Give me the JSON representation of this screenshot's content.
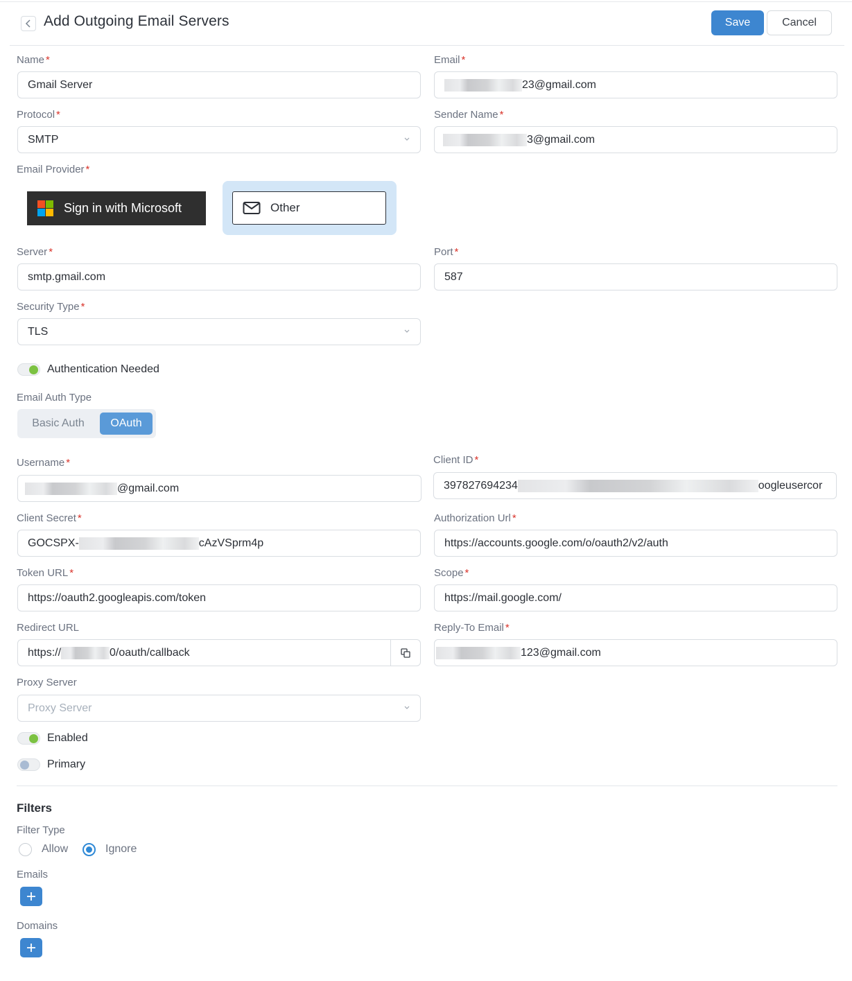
{
  "header": {
    "title": "Add Outgoing Email Servers",
    "save_label": "Save",
    "cancel_label": "Cancel"
  },
  "form": {
    "name": {
      "label": "Name",
      "value": "Gmail Server"
    },
    "email": {
      "label": "Email",
      "value_visible": "23@gmail.com"
    },
    "protocol": {
      "label": "Protocol",
      "value": "SMTP"
    },
    "sender_name": {
      "label": "Sender Name",
      "value_visible": "3@gmail.com"
    },
    "email_provider": {
      "label": "Email Provider",
      "microsoft_label": "Sign in with Microsoft",
      "other_label": "Other",
      "selected": "Other"
    },
    "server": {
      "label": "Server",
      "value": "smtp.gmail.com"
    },
    "port": {
      "label": "Port",
      "value": "587"
    },
    "security_type": {
      "label": "Security Type",
      "value": "TLS"
    },
    "auth_needed": {
      "label": "Authentication Needed",
      "on": true
    },
    "email_auth_type": {
      "label": "Email Auth Type",
      "basic_label": "Basic Auth",
      "oauth_label": "OAuth",
      "selected": "OAuth"
    },
    "username": {
      "label": "Username",
      "value_visible": "@gmail.com"
    },
    "client_id": {
      "label": "Client ID",
      "value_prefix": "397827694234",
      "value_suffix": "oogleusercor"
    },
    "client_secret": {
      "label": "Client Secret",
      "value_prefix": "GOCSPX-",
      "value_suffix": "cAzVSprm4p"
    },
    "authorization_url": {
      "label": "Authorization Url",
      "value": "https://accounts.google.com/o/oauth2/v2/auth"
    },
    "token_url": {
      "label": "Token URL",
      "value": "https://oauth2.googleapis.com/token"
    },
    "scope": {
      "label": "Scope",
      "value": "https://mail.google.com/"
    },
    "redirect_url": {
      "label": "Redirect URL",
      "value_prefix": "https://",
      "value_suffix": "0/oauth/callback"
    },
    "reply_to_email": {
      "label": "Reply-To Email",
      "value_visible": "123@gmail.com"
    },
    "proxy_server": {
      "label": "Proxy Server",
      "placeholder": "Proxy Server"
    },
    "enabled": {
      "label": "Enabled",
      "on": true
    },
    "primary": {
      "label": "Primary",
      "on": false
    }
  },
  "filters": {
    "title": "Filters",
    "filter_type_label": "Filter Type",
    "options": [
      "Allow",
      "Ignore"
    ],
    "selected": "Ignore",
    "emails_label": "Emails",
    "domains_label": "Domains"
  },
  "colors": {
    "primary": "#3d86d0",
    "toggle_on": "#7cc242",
    "required": "#d9342b",
    "provider_selected_bg": "#d3e6f7"
  }
}
